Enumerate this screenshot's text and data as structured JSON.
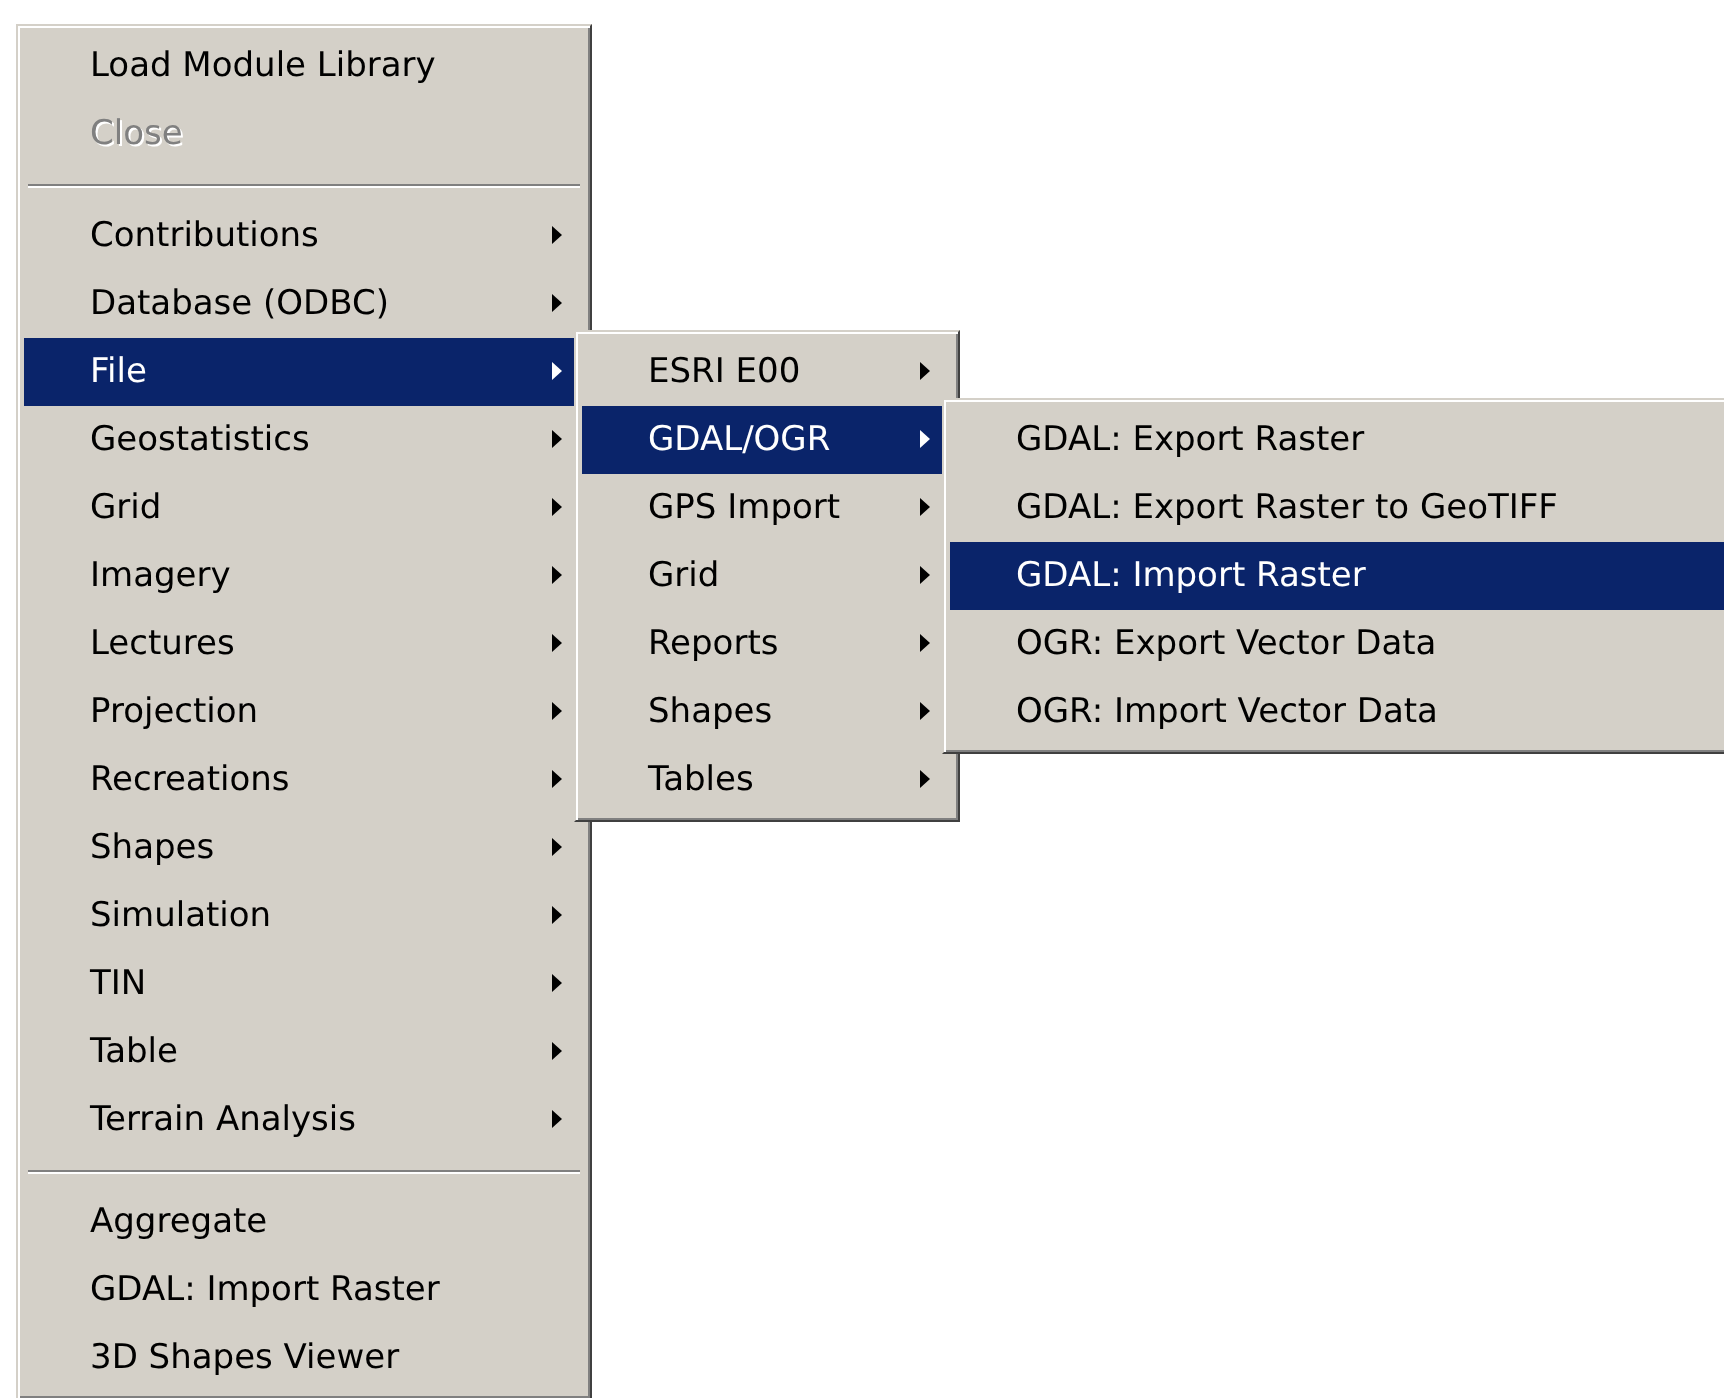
{
  "menus": [
    {
      "items": [
        {
          "kind": "command",
          "label": "Load Module Library",
          "disabled": false,
          "selected": false
        },
        {
          "kind": "command",
          "label": "Close",
          "disabled": true,
          "selected": false
        },
        {
          "kind": "separator"
        },
        {
          "kind": "submenu",
          "label": "Contributions",
          "disabled": false,
          "selected": false
        },
        {
          "kind": "submenu",
          "label": "Database (ODBC)",
          "disabled": false,
          "selected": false
        },
        {
          "kind": "submenu",
          "label": "File",
          "disabled": false,
          "selected": true
        },
        {
          "kind": "submenu",
          "label": "Geostatistics",
          "disabled": false,
          "selected": false
        },
        {
          "kind": "submenu",
          "label": "Grid",
          "disabled": false,
          "selected": false
        },
        {
          "kind": "submenu",
          "label": "Imagery",
          "disabled": false,
          "selected": false
        },
        {
          "kind": "submenu",
          "label": "Lectures",
          "disabled": false,
          "selected": false
        },
        {
          "kind": "submenu",
          "label": "Projection",
          "disabled": false,
          "selected": false
        },
        {
          "kind": "submenu",
          "label": "Recreations",
          "disabled": false,
          "selected": false
        },
        {
          "kind": "submenu",
          "label": "Shapes",
          "disabled": false,
          "selected": false
        },
        {
          "kind": "submenu",
          "label": "Simulation",
          "disabled": false,
          "selected": false
        },
        {
          "kind": "submenu",
          "label": "TIN",
          "disabled": false,
          "selected": false
        },
        {
          "kind": "submenu",
          "label": "Table",
          "disabled": false,
          "selected": false
        },
        {
          "kind": "submenu",
          "label": "Terrain Analysis",
          "disabled": false,
          "selected": false
        },
        {
          "kind": "separator"
        },
        {
          "kind": "command",
          "label": "Aggregate",
          "disabled": false,
          "selected": false
        },
        {
          "kind": "command",
          "label": "GDAL: Import Raster",
          "disabled": false,
          "selected": false
        },
        {
          "kind": "command",
          "label": "3D Shapes Viewer",
          "disabled": false,
          "selected": false
        }
      ]
    },
    {
      "items": [
        {
          "kind": "submenu",
          "label": "ESRI E00",
          "disabled": false,
          "selected": false
        },
        {
          "kind": "submenu",
          "label": "GDAL/OGR",
          "disabled": false,
          "selected": true
        },
        {
          "kind": "submenu",
          "label": "GPS Import",
          "disabled": false,
          "selected": false
        },
        {
          "kind": "submenu",
          "label": "Grid",
          "disabled": false,
          "selected": false
        },
        {
          "kind": "submenu",
          "label": "Reports",
          "disabled": false,
          "selected": false
        },
        {
          "kind": "submenu",
          "label": "Shapes",
          "disabled": false,
          "selected": false
        },
        {
          "kind": "submenu",
          "label": "Tables",
          "disabled": false,
          "selected": false
        }
      ]
    },
    {
      "items": [
        {
          "kind": "command",
          "label": "GDAL: Export Raster",
          "disabled": false,
          "selected": false
        },
        {
          "kind": "command",
          "label": "GDAL: Export Raster to GeoTIFF",
          "disabled": false,
          "selected": false
        },
        {
          "kind": "command",
          "label": "GDAL: Import Raster",
          "disabled": false,
          "selected": true
        },
        {
          "kind": "command",
          "label": "OGR: Export Vector Data",
          "disabled": false,
          "selected": false
        },
        {
          "kind": "command",
          "label": "OGR: Import Vector Data",
          "disabled": false,
          "selected": false
        }
      ]
    }
  ]
}
